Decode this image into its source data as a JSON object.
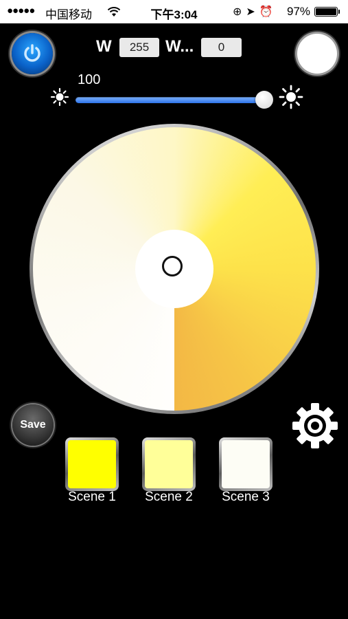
{
  "status_bar": {
    "signal": "●●●●●",
    "carrier": "中国移动",
    "time": "下午3:04",
    "icons": "⊕➤⏰",
    "battery": "97%"
  },
  "toolbar": {
    "w1_label": "W",
    "w1_value": "255",
    "w2_label": "W...",
    "w2_value": "0"
  },
  "brightness": {
    "value": "100",
    "level_percent": 100,
    "slider_color": "#2e73e8"
  },
  "wheel": {
    "selected_color": "#ffffff"
  },
  "actions": {
    "save_label": "Save"
  },
  "scenes": [
    {
      "label": "Scene 1",
      "color": "#ffff00"
    },
    {
      "label": "Scene 2",
      "color": "#ffff99"
    },
    {
      "label": "Scene 3",
      "color": "#fdfdf5"
    }
  ],
  "icons": {
    "power": "power-icon",
    "sun": "sun-icon",
    "gear": "gear-icon",
    "wifi": "wifi-icon"
  }
}
